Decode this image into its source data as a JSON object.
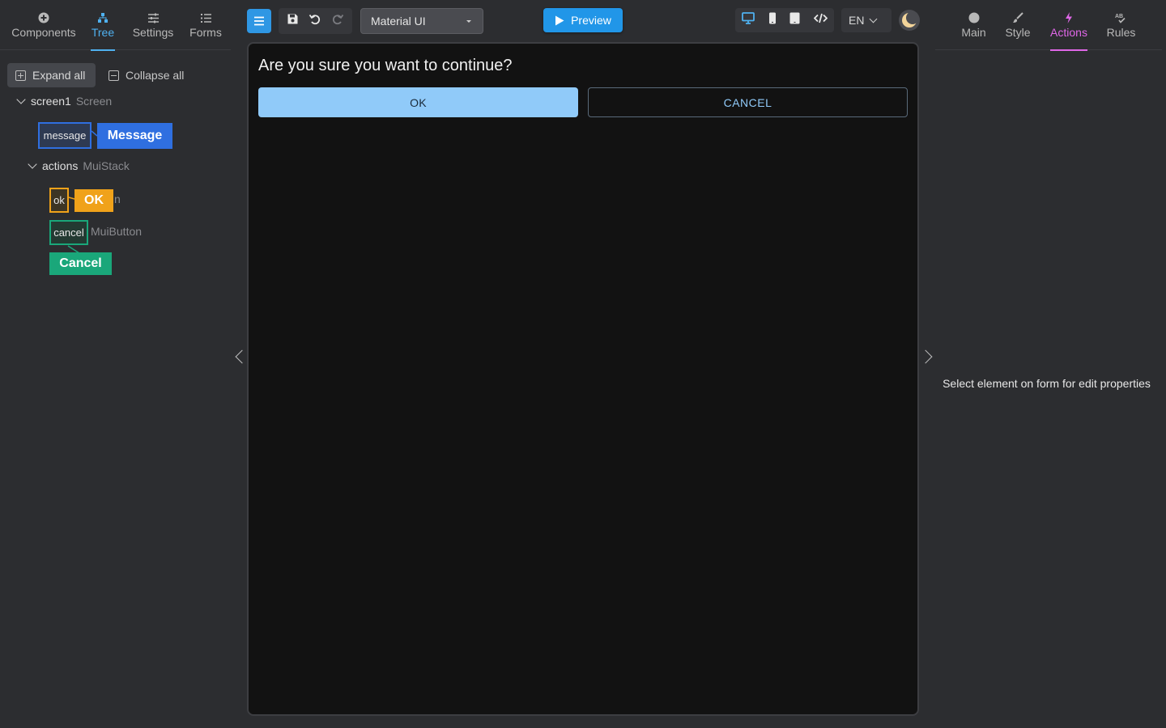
{
  "left_tabs": [
    {
      "label": "Components",
      "icon": "plus-circle-icon"
    },
    {
      "label": "Tree",
      "icon": "hierarchy-icon"
    },
    {
      "label": "Settings",
      "icon": "sliders-icon"
    },
    {
      "label": "Forms",
      "icon": "list-icon"
    }
  ],
  "tree": {
    "expand_all": "Expand all",
    "collapse_all": "Collapse all",
    "root": {
      "name": "screen1",
      "type": "Screen"
    },
    "message": {
      "key": "message",
      "tag": "Message"
    },
    "actions": {
      "name": "actions",
      "type": "MuiStack"
    },
    "ok": {
      "key": "ok",
      "tag": "OK",
      "partial_type": "n"
    },
    "cancel": {
      "key": "cancel",
      "type": "MuiButton",
      "tag": "Cancel"
    }
  },
  "toolbar": {
    "ui_library": "Material UI",
    "preview_label": "Preview",
    "language": "EN"
  },
  "canvas": {
    "message": "Are you sure you want to continue?",
    "ok_label": "OK",
    "cancel_label": "CANCEL"
  },
  "right_tabs": [
    {
      "label": "Main",
      "icon": "circle-icon"
    },
    {
      "label": "Style",
      "icon": "brush-icon"
    },
    {
      "label": "Actions",
      "icon": "lightning-icon"
    },
    {
      "label": "Rules",
      "icon": "rules-icon"
    }
  ],
  "properties_hint": "Select element on form for edit properties",
  "colors": {
    "tree_accent": "#4fb1f0",
    "actions_accent": "#e067e8",
    "message_tag": "#2f6fe0",
    "ok_tag": "#f0a21a",
    "cancel_tag": "#1aa77a",
    "ok_button": "#90caf9"
  }
}
